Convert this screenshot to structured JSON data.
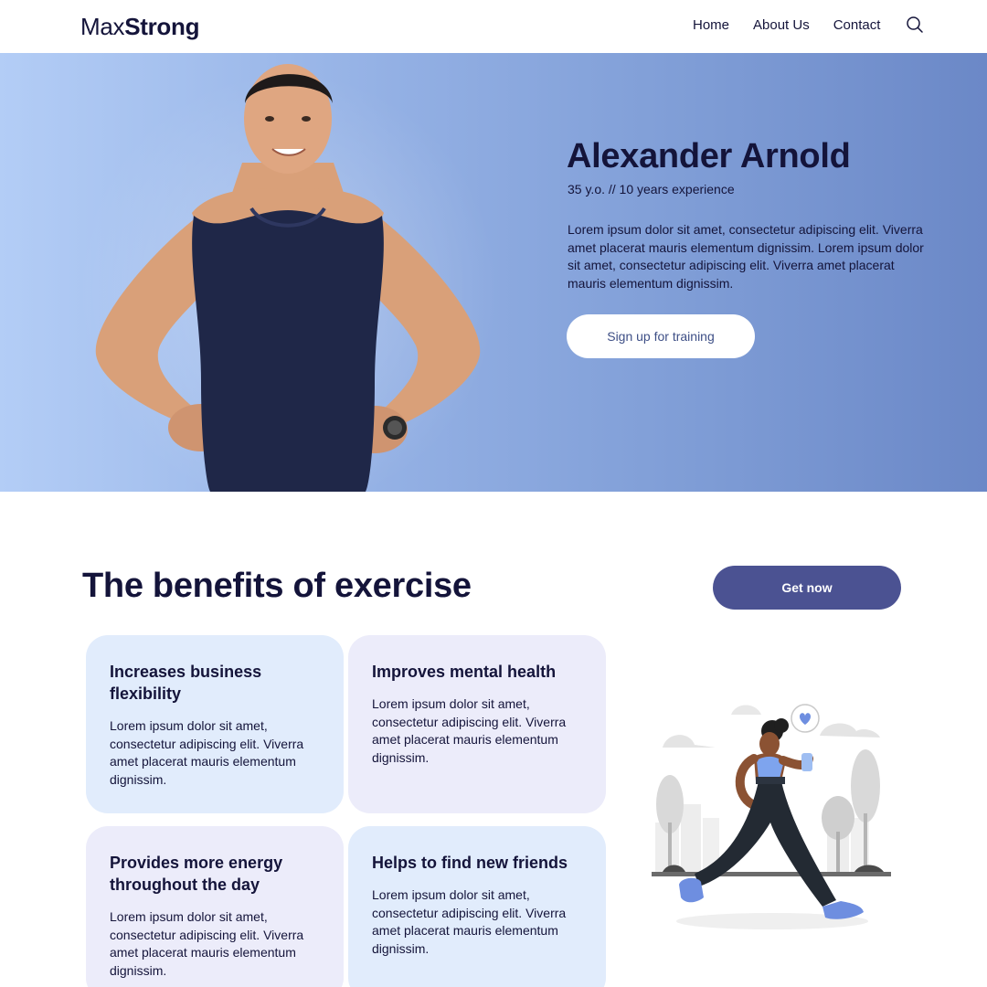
{
  "header": {
    "logo_light": "Max",
    "logo_bold": "Strong",
    "nav": [
      "Home",
      "About Us",
      "Contact"
    ],
    "search_icon": "search-icon"
  },
  "hero": {
    "name": "Alexander Arnold",
    "subtitle": "35 y.o. // 10 years experience",
    "description": "Lorem ipsum dolor sit amet, consectetur adipiscing elit. Viverra amet placerat mauris elementum dignissim. Lorem ipsum dolor sit amet, consectetur adipiscing elit. Viverra amet placerat mauris elementum dignissim.",
    "cta_label": "Sign up for training"
  },
  "benefits": {
    "title_bold": "The benefits",
    "title_light": "of exercise",
    "cta_label": "Get now",
    "cards": [
      {
        "title": "Increases business flexibility",
        "text": "Lorem ipsum dolor sit amet, consectetur adipiscing elit. Viverra amet placerat mauris elementum dignissim."
      },
      {
        "title": "Improves mental health",
        "text": "Lorem ipsum dolor sit amet, consectetur adipiscing elit. Viverra amet placerat mauris elementum dignissim."
      },
      {
        "title": "Provides more energy throughout the day",
        "text": "Lorem ipsum dolor sit amet, consectetur adipiscing elit. Viverra amet placerat mauris elementum dignissim."
      },
      {
        "title": "Helps to find new friends",
        "text": "Lorem ipsum dolor sit amet, consectetur adipiscing elit. Viverra amet placerat mauris elementum dignissim."
      }
    ]
  },
  "colors": {
    "primary_dark": "#14143a",
    "accent": "#4b5292",
    "hero_gradient_start": "#b3cdf6",
    "hero_gradient_end": "#6b88c7"
  }
}
